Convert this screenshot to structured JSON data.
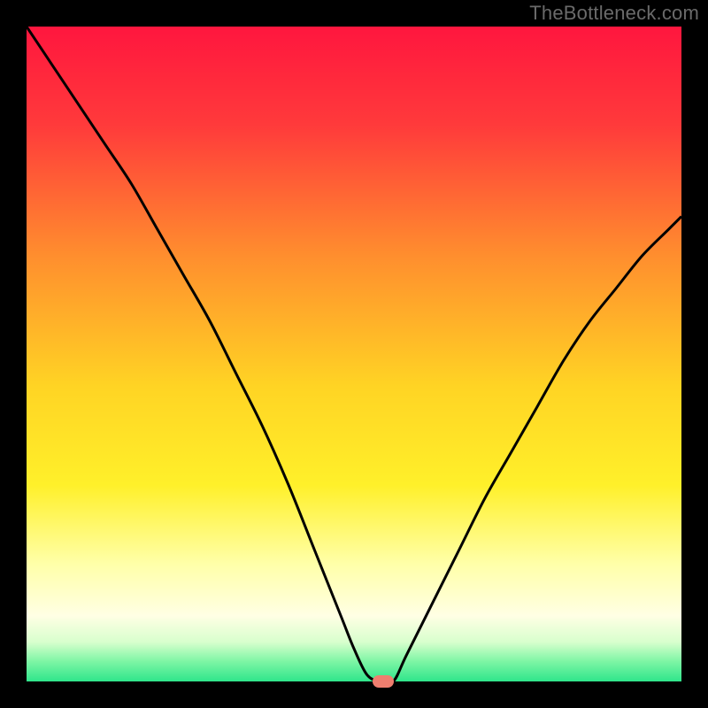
{
  "watermark": {
    "text": "TheBottleneck.com"
  },
  "chart_data": {
    "type": "line",
    "title": "",
    "xlabel": "",
    "ylabel": "",
    "xlim": [
      0,
      100
    ],
    "ylim": [
      0,
      100
    ],
    "grid": false,
    "background": {
      "gradient_stops": [
        {
          "pos": 0.0,
          "color": "#ff163e"
        },
        {
          "pos": 0.15,
          "color": "#ff3a3b"
        },
        {
          "pos": 0.35,
          "color": "#ff8e2e"
        },
        {
          "pos": 0.55,
          "color": "#ffd424"
        },
        {
          "pos": 0.7,
          "color": "#fff02a"
        },
        {
          "pos": 0.82,
          "color": "#ffffa8"
        },
        {
          "pos": 0.9,
          "color": "#ffffe4"
        },
        {
          "pos": 0.94,
          "color": "#d8ffcd"
        },
        {
          "pos": 0.97,
          "color": "#7cf5a4"
        },
        {
          "pos": 1.0,
          "color": "#2fe58b"
        }
      ]
    },
    "series": [
      {
        "name": "bottleneck-curve",
        "color": "#000000",
        "stroke_width": 3,
        "x": [
          0,
          4,
          8,
          12,
          16,
          20,
          24,
          28,
          32,
          36,
          40,
          44,
          48,
          50,
          52,
          54,
          56,
          58,
          62,
          66,
          70,
          74,
          78,
          82,
          86,
          90,
          94,
          98,
          100
        ],
        "y": [
          100,
          94,
          88,
          82,
          76,
          69,
          62,
          55,
          47,
          39,
          30,
          20,
          10,
          5,
          1,
          0,
          0,
          4,
          12,
          20,
          28,
          35,
          42,
          49,
          55,
          60,
          65,
          69,
          71
        ]
      }
    ],
    "marker": {
      "name": "optimal-point",
      "x": 54.5,
      "y": 0,
      "color": "#ef7e6f"
    }
  }
}
